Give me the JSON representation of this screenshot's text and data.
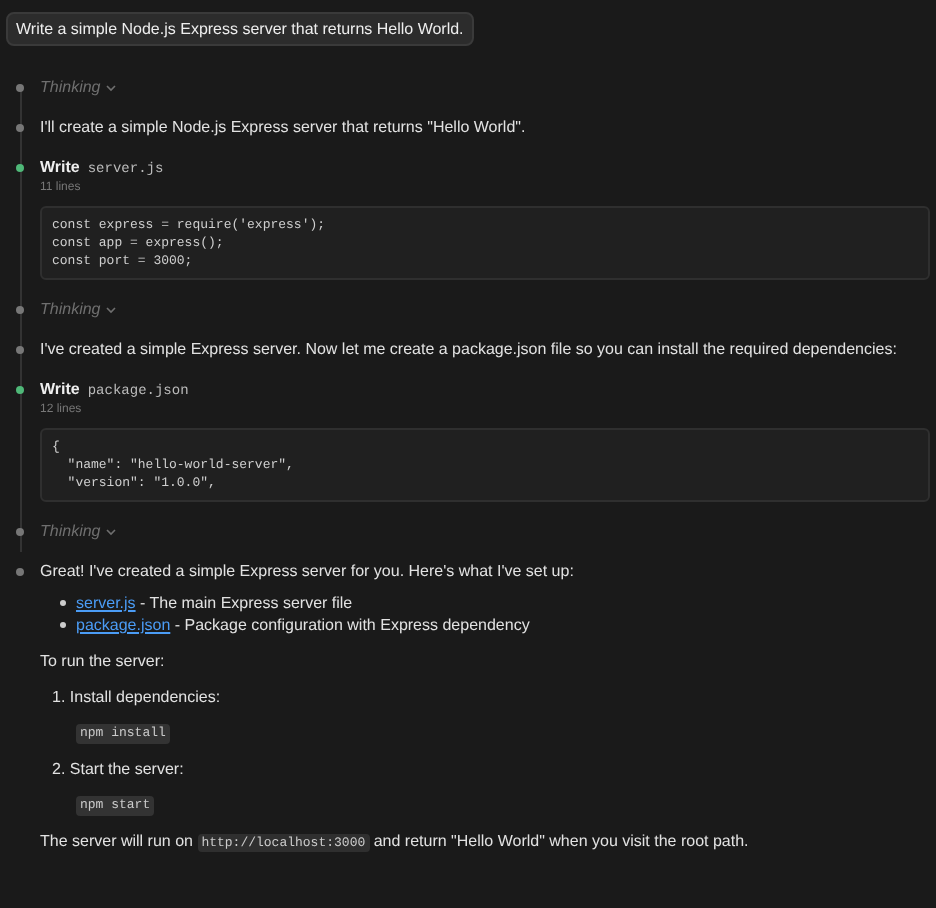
{
  "prompt": "Write a simple Node.js Express server that returns Hello World.",
  "steps": [
    {
      "kind": "thinking",
      "label": "Thinking"
    },
    {
      "kind": "text",
      "text": "I'll create a simple Node.js Express server that returns \"Hello World\"."
    },
    {
      "kind": "write",
      "action": "Write",
      "file": "server.js",
      "line_count": "11 lines",
      "code": [
        "const express = require('express');",
        "const app = express();",
        "const port = 3000;"
      ]
    },
    {
      "kind": "thinking",
      "label": "Thinking"
    },
    {
      "kind": "text",
      "text": "I've created a simple Express server. Now let me create a package.json file so you can install the required dependencies:"
    },
    {
      "kind": "write",
      "action": "Write",
      "file": "package.json",
      "line_count": "12 lines",
      "code": [
        "{",
        "  \"name\": \"hello-world-server\",",
        "  \"version\": \"1.0.0\","
      ]
    },
    {
      "kind": "thinking",
      "label": "Thinking"
    },
    {
      "kind": "summary",
      "intro": "Great! I've created a simple Express server for you. Here's what I've set up:",
      "files": [
        {
          "link": "server.js",
          "description": " - The main Express server file"
        },
        {
          "link": "package.json",
          "description": " - Package configuration with Express dependency"
        }
      ],
      "run_heading": "To run the server:",
      "run_steps": [
        {
          "number": "1.",
          "label": "Install dependencies:",
          "command": "npm install"
        },
        {
          "number": "2.",
          "label": "Start the server:",
          "command": "npm start"
        }
      ],
      "closing": {
        "before": "The server will run on ",
        "code": "http://localhost:3000",
        "after": " and return \"Hello World\" when you visit the root path."
      }
    }
  ]
}
